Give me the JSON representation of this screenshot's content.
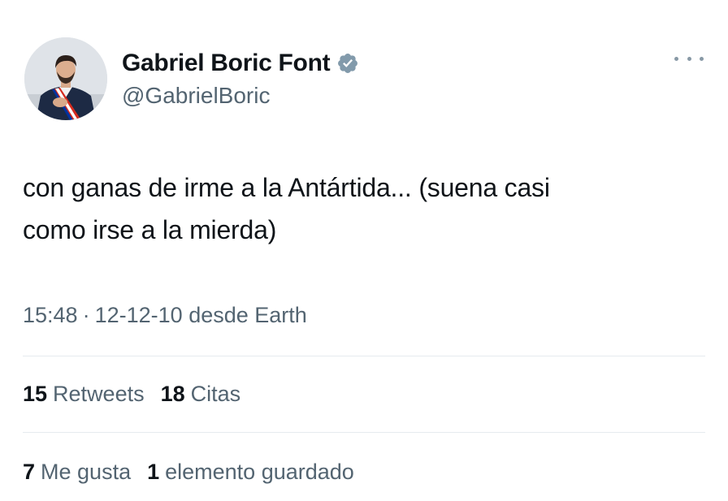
{
  "user": {
    "display_name": "Gabriel Boric Font",
    "handle": "@GabrielBoric",
    "verified_icon": "verified-badge-icon",
    "avatar_icon": "avatar"
  },
  "tweet": {
    "text_line1": "con ganas de irme a la Antártida... (suena casi",
    "text_line2": "como irse a la mierda)",
    "time": "15:48",
    "separator": "·",
    "date": "12-12-10",
    "source": "desde Earth"
  },
  "stats": {
    "retweets": {
      "count": "15",
      "label": "Retweets"
    },
    "quotes": {
      "count": "18",
      "label": "Citas"
    },
    "likes": {
      "count": "7",
      "label": "Me gusta"
    },
    "bookmarks": {
      "count": "1",
      "label": "elemento guardado"
    }
  },
  "colors": {
    "text": "#0f1419",
    "secondary": "#536471",
    "divider": "#e6ebef",
    "badge": "#829aab"
  }
}
